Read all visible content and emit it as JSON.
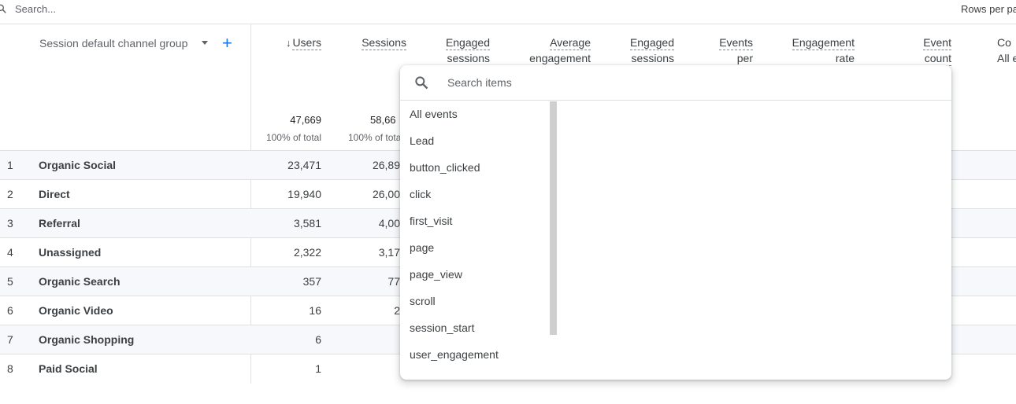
{
  "topbar": {
    "search_placeholder": "Search...",
    "rows_per_page_label": "Rows per pa"
  },
  "dimension": {
    "label": "Session default channel group",
    "add_label": "+"
  },
  "columns": [
    {
      "line1": "Users",
      "line2": "",
      "sorted": true
    },
    {
      "line1": "Sessions",
      "line2": ""
    },
    {
      "line1": "Engaged",
      "line2": "sessions"
    },
    {
      "line1": "Average",
      "line2": "engagement"
    },
    {
      "line1": "Engaged",
      "line2": "sessions"
    },
    {
      "line1": "Events",
      "line2": "per"
    },
    {
      "line1": "Engagement",
      "line2": "rate"
    },
    {
      "line1": "Event",
      "line2": "count"
    },
    {
      "line1": "Co",
      "line2": "All e"
    }
  ],
  "sort_arrow": "↓",
  "totals": {
    "users": "47,669",
    "users_pct": "100% of total",
    "sessions": "58,66",
    "sessions_pct": "100% of tota"
  },
  "rows": [
    {
      "idx": "1",
      "name": "Organic Social",
      "users": "23,471",
      "sessions": "26,89"
    },
    {
      "idx": "2",
      "name": "Direct",
      "users": "19,940",
      "sessions": "26,00"
    },
    {
      "idx": "3",
      "name": "Referral",
      "users": "3,581",
      "sessions": "4,00"
    },
    {
      "idx": "4",
      "name": "Unassigned",
      "users": "2,322",
      "sessions": "3,17"
    },
    {
      "idx": "5",
      "name": "Organic Search",
      "users": "357",
      "sessions": "77"
    },
    {
      "idx": "6",
      "name": "Organic Video",
      "users": "16",
      "sessions": "2"
    },
    {
      "idx": "7",
      "name": "Organic Shopping",
      "users": "6",
      "sessions": ""
    },
    {
      "idx": "8",
      "name": "Paid Social",
      "users": "1",
      "sessions": ""
    }
  ],
  "popup": {
    "search_placeholder": "Search items",
    "items": [
      "All events",
      "Lead",
      "button_clicked",
      "click",
      "first_visit",
      "page",
      "page_view",
      "scroll",
      "session_start",
      "user_engagement"
    ]
  },
  "colors": {
    "accent": "#1a73e8",
    "row_shade": "#f6f8fc",
    "border": "#e0e0e0"
  }
}
